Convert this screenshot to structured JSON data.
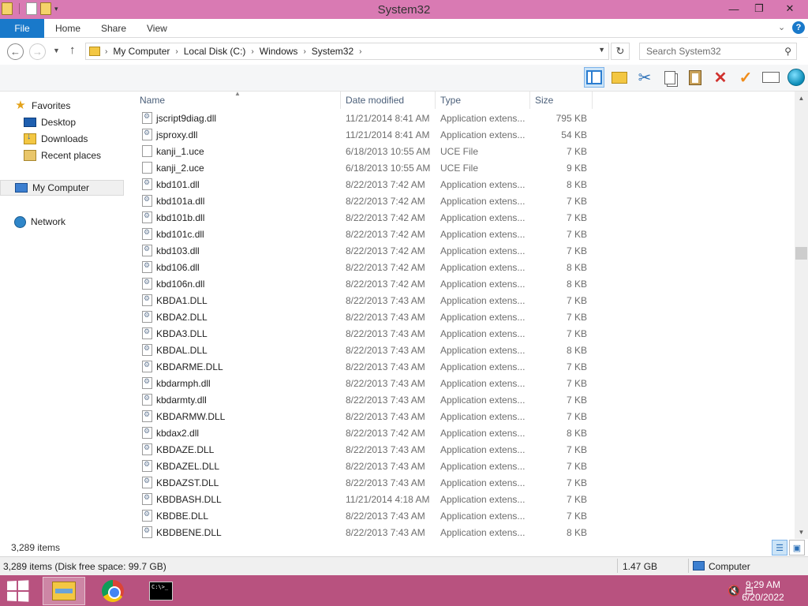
{
  "window": {
    "title": "System32",
    "controls": {
      "minimize": "—",
      "maximize": "❐",
      "close": "✕"
    }
  },
  "ribbon": {
    "tabs": [
      "File",
      "Home",
      "Share",
      "View"
    ],
    "expand": "⌄",
    "help": "?"
  },
  "address": {
    "crumbs": [
      "My Computer",
      "Local Disk (C:)",
      "Windows",
      "System32"
    ],
    "search_placeholder": "Search System32"
  },
  "nav_pane": {
    "favorites": "Favorites",
    "favorite_items": [
      "Desktop",
      "Downloads",
      "Recent places"
    ],
    "my_computer": "My Computer",
    "network": "Network"
  },
  "columns": {
    "name": "Name",
    "date": "Date modified",
    "type": "Type",
    "size": "Size"
  },
  "files": [
    {
      "name": "jscript9diag.dll",
      "date": "11/21/2014 8:41 AM",
      "type": "Application extens...",
      "size": "795 KB",
      "icon": "dll-icon"
    },
    {
      "name": "jsproxy.dll",
      "date": "11/21/2014 8:41 AM",
      "type": "Application extens...",
      "size": "54 KB",
      "icon": "dll-icon"
    },
    {
      "name": "kanji_1.uce",
      "date": "6/18/2013 10:55 AM",
      "type": "UCE File",
      "size": "7 KB",
      "icon": "file-icon"
    },
    {
      "name": "kanji_2.uce",
      "date": "6/18/2013 10:55 AM",
      "type": "UCE File",
      "size": "9 KB",
      "icon": "file-icon"
    },
    {
      "name": "kbd101.dll",
      "date": "8/22/2013 7:42 AM",
      "type": "Application extens...",
      "size": "8 KB",
      "icon": "dll-icon"
    },
    {
      "name": "kbd101a.dll",
      "date": "8/22/2013 7:42 AM",
      "type": "Application extens...",
      "size": "7 KB",
      "icon": "dll-icon"
    },
    {
      "name": "kbd101b.dll",
      "date": "8/22/2013 7:42 AM",
      "type": "Application extens...",
      "size": "7 KB",
      "icon": "dll-icon"
    },
    {
      "name": "kbd101c.dll",
      "date": "8/22/2013 7:42 AM",
      "type": "Application extens...",
      "size": "7 KB",
      "icon": "dll-icon"
    },
    {
      "name": "kbd103.dll",
      "date": "8/22/2013 7:42 AM",
      "type": "Application extens...",
      "size": "7 KB",
      "icon": "dll-icon"
    },
    {
      "name": "kbd106.dll",
      "date": "8/22/2013 7:42 AM",
      "type": "Application extens...",
      "size": "8 KB",
      "icon": "dll-icon"
    },
    {
      "name": "kbd106n.dll",
      "date": "8/22/2013 7:42 AM",
      "type": "Application extens...",
      "size": "8 KB",
      "icon": "dll-icon"
    },
    {
      "name": "KBDA1.DLL",
      "date": "8/22/2013 7:43 AM",
      "type": "Application extens...",
      "size": "7 KB",
      "icon": "dll-icon"
    },
    {
      "name": "KBDA2.DLL",
      "date": "8/22/2013 7:43 AM",
      "type": "Application extens...",
      "size": "7 KB",
      "icon": "dll-icon"
    },
    {
      "name": "KBDA3.DLL",
      "date": "8/22/2013 7:43 AM",
      "type": "Application extens...",
      "size": "7 KB",
      "icon": "dll-icon"
    },
    {
      "name": "KBDAL.DLL",
      "date": "8/22/2013 7:43 AM",
      "type": "Application extens...",
      "size": "8 KB",
      "icon": "dll-icon"
    },
    {
      "name": "KBDARME.DLL",
      "date": "8/22/2013 7:43 AM",
      "type": "Application extens...",
      "size": "7 KB",
      "icon": "dll-icon"
    },
    {
      "name": "kbdarmph.dll",
      "date": "8/22/2013 7:43 AM",
      "type": "Application extens...",
      "size": "7 KB",
      "icon": "dll-icon"
    },
    {
      "name": "kbdarmty.dll",
      "date": "8/22/2013 7:43 AM",
      "type": "Application extens...",
      "size": "7 KB",
      "icon": "dll-icon"
    },
    {
      "name": "KBDARMW.DLL",
      "date": "8/22/2013 7:43 AM",
      "type": "Application extens...",
      "size": "7 KB",
      "icon": "dll-icon"
    },
    {
      "name": "kbdax2.dll",
      "date": "8/22/2013 7:42 AM",
      "type": "Application extens...",
      "size": "8 KB",
      "icon": "dll-icon"
    },
    {
      "name": "KBDAZE.DLL",
      "date": "8/22/2013 7:43 AM",
      "type": "Application extens...",
      "size": "7 KB",
      "icon": "dll-icon"
    },
    {
      "name": "KBDAZEL.DLL",
      "date": "8/22/2013 7:43 AM",
      "type": "Application extens...",
      "size": "7 KB",
      "icon": "dll-icon"
    },
    {
      "name": "KBDAZST.DLL",
      "date": "8/22/2013 7:43 AM",
      "type": "Application extens...",
      "size": "7 KB",
      "icon": "dll-icon"
    },
    {
      "name": "KBDBASH.DLL",
      "date": "11/21/2014 4:18 AM",
      "type": "Application extens...",
      "size": "7 KB",
      "icon": "dll-icon"
    },
    {
      "name": "KBDBE.DLL",
      "date": "8/22/2013 7:43 AM",
      "type": "Application extens...",
      "size": "7 KB",
      "icon": "dll-icon"
    },
    {
      "name": "KBDBENE.DLL",
      "date": "8/22/2013 7:43 AM",
      "type": "Application extens...",
      "size": "8 KB",
      "icon": "dll-icon"
    }
  ],
  "item_count": "3,289 items",
  "status": {
    "items_free": "3,289 items (Disk free space: 99.7 GB)",
    "size": "1.47 GB",
    "location": "Computer"
  },
  "taskbar": {
    "apps": [
      "file-explorer-icon",
      "chrome-icon",
      "command-prompt-icon"
    ],
    "cmd_text": "C:\\>_",
    "time": "9:29 AM",
    "date": "6/20/2022"
  },
  "colors": {
    "titlebar": "#d97ab3",
    "taskbar": "#b8527f",
    "file_tab": "#1979ca"
  }
}
